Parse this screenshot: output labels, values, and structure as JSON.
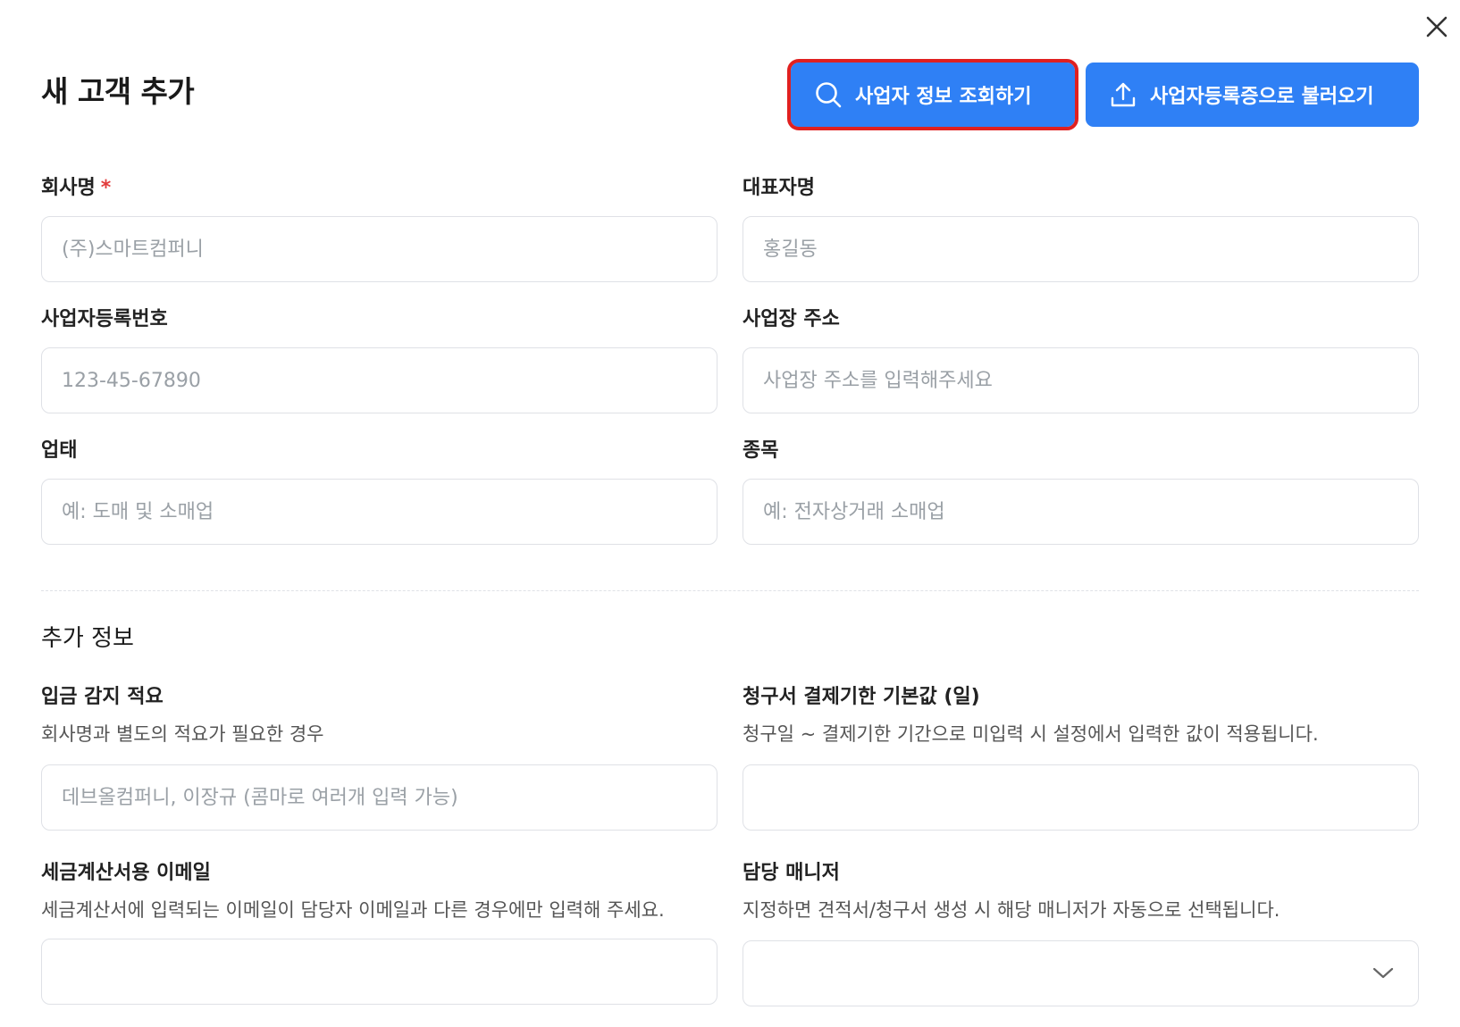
{
  "dialog": {
    "title": "새 고객 추가",
    "close_icon": "close-icon"
  },
  "actions": {
    "lookup_label": "사업자 정보 조회하기",
    "lookup_icon": "search-icon",
    "upload_label": "사업자등록증으로 불러오기",
    "upload_icon": "upload-icon",
    "accent_color": "#2f80f5",
    "highlight_color": "#e02020"
  },
  "fields": {
    "company_name": {
      "label": "회사명",
      "required_mark": "*",
      "placeholder": "(주)스마트컴퍼니"
    },
    "ceo_name": {
      "label": "대표자명",
      "placeholder": "홍길동"
    },
    "biz_number": {
      "label": "사업자등록번호",
      "placeholder": "123-45-67890"
    },
    "biz_address": {
      "label": "사업장 주소",
      "placeholder": "사업장 주소를 입력해주세요"
    },
    "biz_type": {
      "label": "업태",
      "placeholder": "예: 도매 및 소매업"
    },
    "biz_item": {
      "label": "종목",
      "placeholder": "예: 전자상거래 소매업"
    }
  },
  "extra": {
    "section_title": "추가 정보",
    "deposit_memo": {
      "label": "입금 감지 적요",
      "help": "회사명과 별도의 적요가 필요한 경우",
      "placeholder": "데브올컴퍼니, 이장규 (콤마로 여러개 입력 가능)"
    },
    "due_days": {
      "label": "청구서 결제기한 기본값 (일)",
      "help": "청구일 ~ 결제기한 기간으로 미입력 시 설정에서 입력한 값이 적용됩니다.",
      "placeholder": ""
    },
    "tax_email": {
      "label": "세금계산서용 이메일",
      "help": "세금계산서에 입력되는 이메일이 담당자 이메일과 다른 경우에만 입력해 주세요.",
      "placeholder": ""
    },
    "manager": {
      "label": "담당 매니저",
      "help": "지정하면 견적서/청구서 생성 시 해당 매니저가 자동으로 선택됩니다.",
      "selected": "",
      "chevron_icon": "chevron-down-icon"
    }
  }
}
